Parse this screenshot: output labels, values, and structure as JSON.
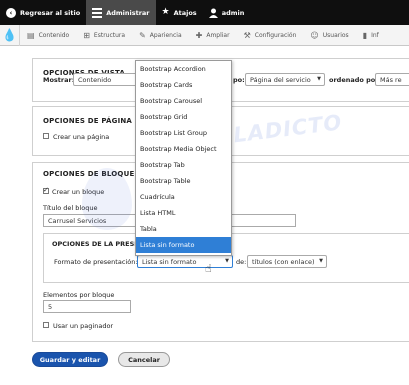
{
  "toolbar": {
    "back": "Regresar al sitio",
    "manage": "Administrar",
    "shortcuts": "Atajos",
    "user": "admin"
  },
  "tray": {
    "items": [
      "Contenido",
      "Estructura",
      "Apariencia",
      "Ampliar",
      "Configuración",
      "Usuarios",
      "Inf"
    ]
  },
  "view_options": {
    "title": "OPCIONES DE VISTA",
    "show_label": "Mostrar:",
    "show_value": "Contenido",
    "type_label": "po:",
    "type_value": "Página del servicio",
    "sort_label": "ordenado por:",
    "sort_value": "Más re"
  },
  "page_options": {
    "title": "OPCIONES DE PÁGINA",
    "create_page": "Crear una página"
  },
  "block_options": {
    "title": "OPCIONES DE BLOQUE",
    "create_block": "Crear un bloque",
    "block_title_label": "Título del bloque",
    "block_title_value": "Carrusel Servicios",
    "presentation_section": "OPCIONES DE LA PRESE",
    "format_label": "Formato de presentación:",
    "format_value": "Lista sin formato",
    "of_label": "de:",
    "of_value": "títulos (con enlace)",
    "items_label": "Elementos por bloque",
    "items_value": "5",
    "pager_label": "Usar un paginador"
  },
  "dropdown": {
    "options": [
      "Bootstrap Accordion",
      "Bootstrap Cards",
      "Bootstrap Carousel",
      "Bootstrap Grid",
      "Bootstrap List Group",
      "Bootstrap Media Object",
      "Bootstrap Tab",
      "Bootstrap Table",
      "Cuadrícula",
      "Lista HTML",
      "Tabla",
      "Lista sin formato"
    ],
    "selected": "Lista sin formato"
  },
  "buttons": {
    "save": "Guardar y editar",
    "cancel": "Cancelar"
  },
  "watermark": "DRUPALADICTO",
  "colors": {
    "toolbar": "#0f0f0f",
    "primary": "#1a54ad",
    "selected": "#2f7fd6",
    "drupal": "#1f84c6"
  }
}
